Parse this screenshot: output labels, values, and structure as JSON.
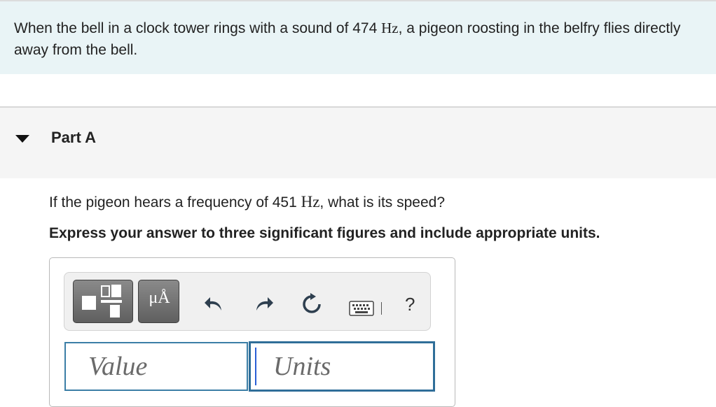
{
  "problem": {
    "text_before_unit": "When the bell in a clock tower rings with a sound of 474 ",
    "unit": "Hz",
    "text_after_unit": ", a pigeon roosting in the belfry flies directly away from the bell."
  },
  "part": {
    "title": "Part A",
    "question_before_unit": "If the pigeon hears a frequency of 451 ",
    "question_unit": "Hz",
    "question_after_unit": ", what is its speed?",
    "instruction": "Express your answer to three significant figures and include appropriate units."
  },
  "toolbar": {
    "templates_icon": "templates-icon",
    "symbols_label": "μÅ",
    "undo_icon": "undo-icon",
    "redo_icon": "redo-icon",
    "reset_icon": "reset-icon",
    "keyboard_icon": "keyboard-icon",
    "help_label": "?"
  },
  "answer": {
    "value_placeholder": "Value",
    "units_placeholder": "Units"
  },
  "colors": {
    "problem_bg": "#e9f4f6",
    "part_bg": "#f5f5f5",
    "field_border": "#3b7ea6"
  }
}
